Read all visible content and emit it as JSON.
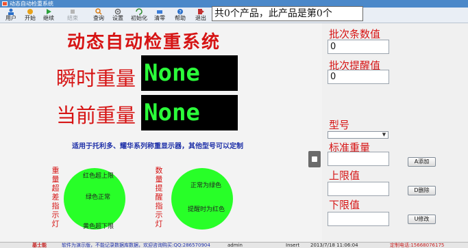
{
  "window": {
    "title": "动态自动检重系统"
  },
  "toolbar": {
    "items": [
      {
        "label": "用户",
        "icon": "user-icon"
      },
      {
        "label": "开始",
        "icon": "start-icon"
      },
      {
        "label": "继续",
        "icon": "continue-icon"
      },
      {
        "label": "结束",
        "icon": "stop-icon",
        "disabled": true
      },
      {
        "label": "查询",
        "icon": "search-icon"
      },
      {
        "label": "设置",
        "icon": "settings-icon"
      },
      {
        "label": "初始化",
        "icon": "init-icon"
      },
      {
        "label": "清零",
        "icon": "clear-icon"
      },
      {
        "label": "帮助",
        "icon": "help-icon"
      },
      {
        "label": "退出",
        "icon": "exit-icon"
      }
    ],
    "count_text": "共0个产品，此产品是第0个"
  },
  "main": {
    "title": "动态自动检重系统",
    "instant_weight_label": "瞬时重量",
    "instant_weight_value": "None",
    "current_weight_label": "当前重量",
    "current_weight_value": "None",
    "hint": "适用于托利多、耀华系列称重显示器，其他型号可以定制",
    "weight_indicator_label": "重量超差指示灯",
    "count_indicator_label": "数量提醒指示灯",
    "weight_circle": {
      "upper": "红色超上限",
      "normal": "绿色正常",
      "lower": "黄色超下限",
      "color": "#28ff28"
    },
    "count_circle": {
      "normal": "正常为绿色",
      "alert": "提醒时为红色",
      "color": "#28ff28"
    }
  },
  "right": {
    "batch_count_label": "批次条数值",
    "batch_count_value": "0",
    "batch_alert_label": "批次提醒值",
    "batch_alert_value": "0",
    "model_label": "型号",
    "model_value": "",
    "standard_weight_label": "标准重量",
    "upper_label": "上限值",
    "lower_label": "下限值",
    "add_button": "A添加",
    "delete_button": "D删除",
    "modify_button": "U修改"
  },
  "status": {
    "company": "基士能",
    "notice": "软件为演示版，不能记录数据库数据，欢迎咨询购买:QQ:286570904",
    "user": "admin",
    "mode": "Insert",
    "datetime": "2013/7/18 11:06:04",
    "phone": "定制电话:15668076175"
  },
  "colors": {
    "accent_red": "#d61414",
    "lcd_green": "#2bff3a",
    "hint_blue": "#1d2fa8"
  }
}
